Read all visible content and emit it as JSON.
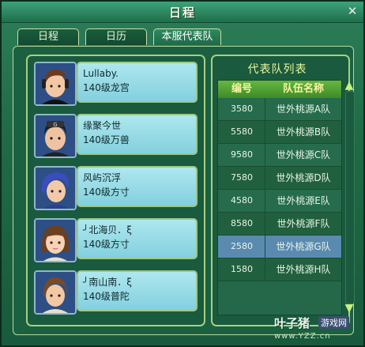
{
  "window": {
    "title": "日程",
    "close_symbol": "✕"
  },
  "tabs": [
    {
      "label": "日程",
      "active": false
    },
    {
      "label": "日历",
      "active": false
    },
    {
      "label": "本服代表队",
      "active": true
    }
  ],
  "members": [
    {
      "name": "Lullaby.",
      "info": "140级龙宫",
      "avatar": "avatar-brown-hair-boy"
    },
    {
      "name": "缘聚今世",
      "info": "140级万兽",
      "avatar": "avatar-black-hair-boy"
    },
    {
      "name": "风屿沉浮",
      "info": "140级方寸",
      "avatar": "avatar-blue-hair-boy"
    },
    {
      "name": "╯北海贝．ξ",
      "info": "140级方寸",
      "avatar": "avatar-girl"
    },
    {
      "name": "╯南山南．ξ",
      "info": "140级普陀",
      "avatar": "avatar-brown-hair-boy-2"
    }
  ],
  "team_list": {
    "title": "代表队列表",
    "headers": {
      "id": "编号",
      "name": "队伍名称"
    },
    "rows": [
      {
        "id": "3580",
        "name": "世外桃源A队",
        "selected": false
      },
      {
        "id": "5580",
        "name": "世外桃源B队",
        "selected": false
      },
      {
        "id": "9580",
        "name": "世外桃源C队",
        "selected": false
      },
      {
        "id": "7580",
        "name": "世外桃源D队",
        "selected": false
      },
      {
        "id": "4580",
        "name": "世外桃源E队",
        "selected": false
      },
      {
        "id": "8580",
        "name": "世外桃源F队",
        "selected": false
      },
      {
        "id": "2580",
        "name": "世外桃源G队",
        "selected": true
      },
      {
        "id": "1580",
        "name": "世外桃源H队",
        "selected": false
      }
    ]
  },
  "scrollbar": {
    "up_icon": "▲",
    "down_icon": "▼"
  },
  "watermark": {
    "brand": "叶子猪",
    "badge": "游戏网",
    "url": "www.YZZ.cn"
  }
}
